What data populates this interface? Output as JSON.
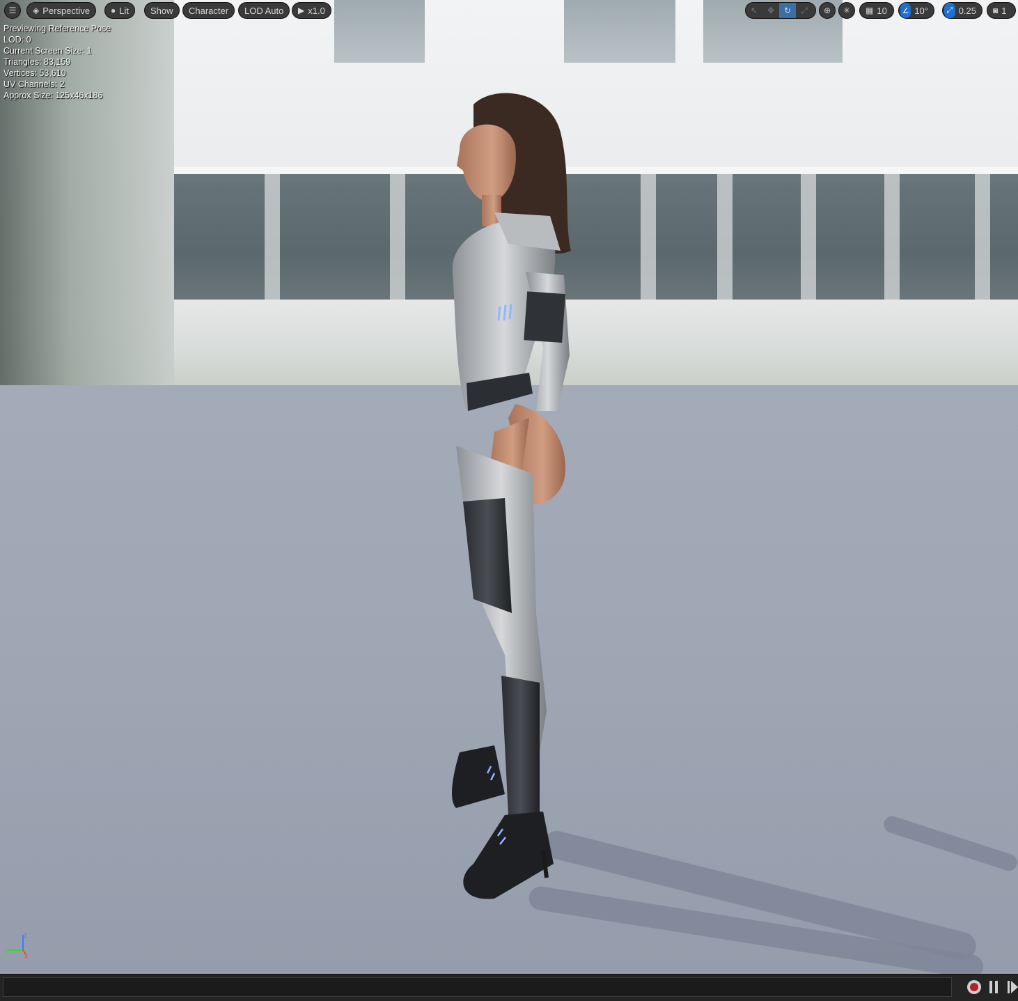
{
  "toolbar": {
    "menu_icon": "hamburger-menu-icon",
    "perspective_label": "Perspective",
    "lit_label": "Lit",
    "show_label": "Show",
    "character_label": "Character",
    "lod_label": "LOD Auto",
    "play_speed_label": "x1.0",
    "grid_snap_value": "10",
    "rotation_snap_value": "10°",
    "scale_snap_value": "0.25",
    "camera_speed_value": "1"
  },
  "stats": {
    "line1": "Previewing Reference Pose",
    "line2": "LOD: 0",
    "line3": "Current Screen Size: 1",
    "line4": "Triangles: 83,159",
    "line5": "Vertices: 53,610",
    "line6": "UV Channels: 2",
    "line7": "Approx Size: 125x46x186"
  },
  "axis": {
    "z": "Z",
    "y": "Y",
    "x": "X"
  },
  "colors": {
    "accent_blue": "#1f6fd1",
    "toolbar_bg": "#3a3a3a",
    "record_red": "#b42323"
  }
}
